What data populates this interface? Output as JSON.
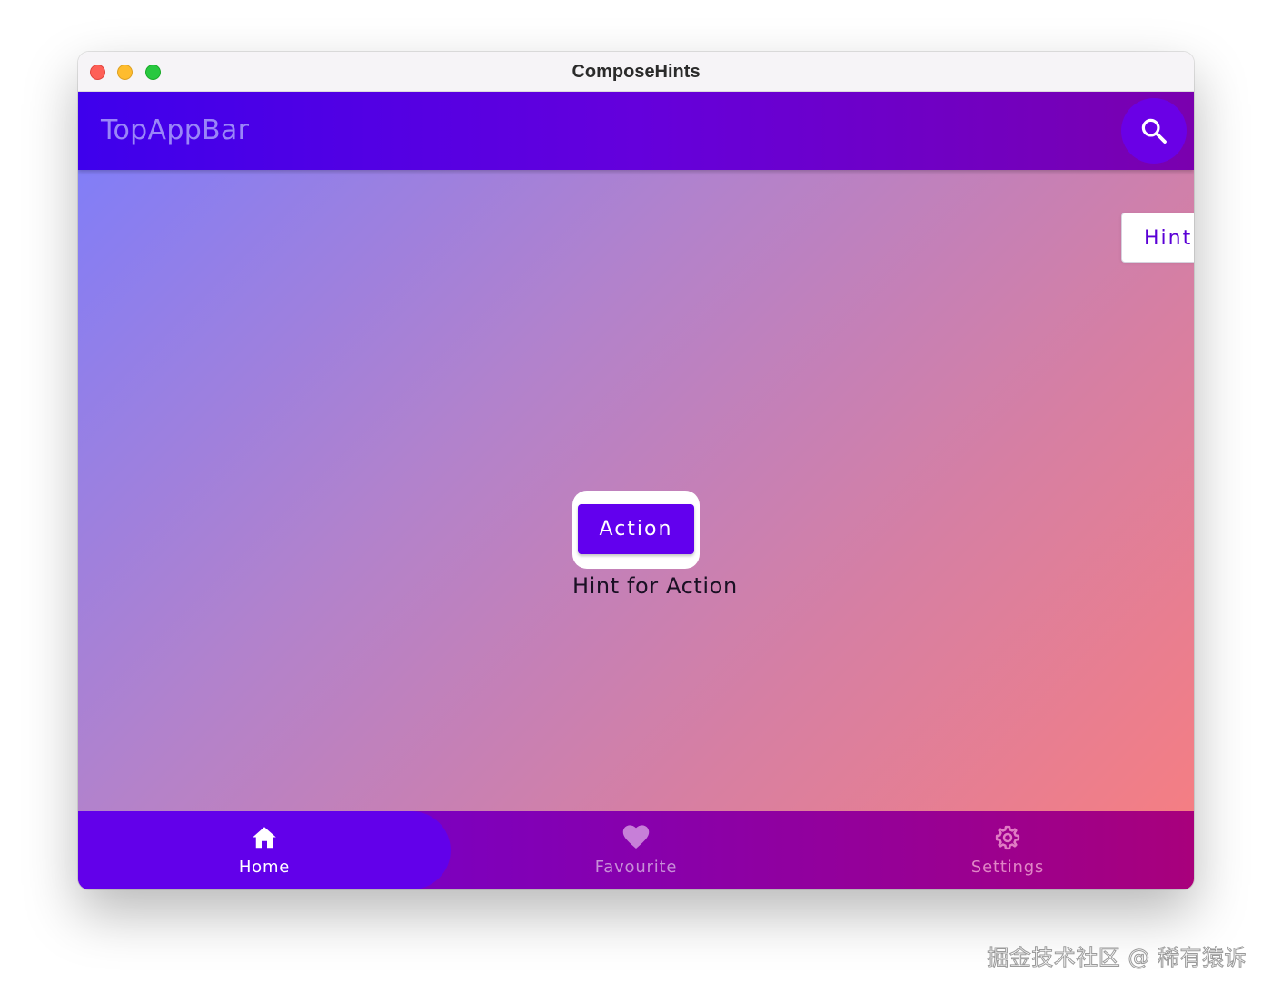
{
  "window": {
    "title": "ComposeHints"
  },
  "top_bar": {
    "title": "TopAppBar",
    "search_icon": "search-icon"
  },
  "hint_popup": {
    "text": "Hint"
  },
  "main": {
    "action_label": "Action",
    "action_hint": "Hint for Action"
  },
  "bottom_nav": {
    "items": [
      {
        "label": "Home",
        "icon": "home-icon",
        "selected": true
      },
      {
        "label": "Favourite",
        "icon": "heart-icon",
        "selected": false
      },
      {
        "label": "Settings",
        "icon": "gear-icon",
        "selected": false
      }
    ]
  },
  "watermark": {
    "text": "掘金技术社区 @ 稀有猿诉"
  },
  "colors": {
    "primary": "#6200ee",
    "top_bar_start": "#3e00ec",
    "top_bar_end": "#7a00ae",
    "content_gradient_start": "#7c7dfc",
    "content_gradient_end": "#f97e7f"
  }
}
